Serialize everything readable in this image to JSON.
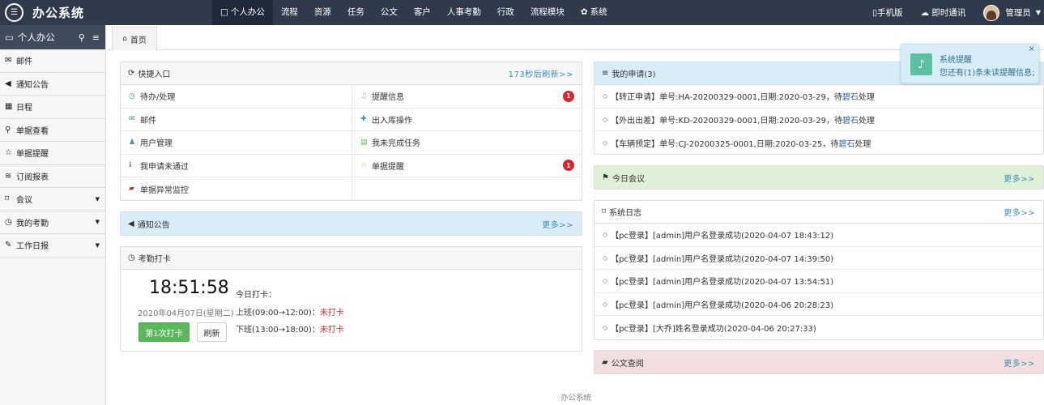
{
  "app": {
    "title": "办公系统"
  },
  "nav": [
    {
      "label": "个人办公",
      "icon": "□"
    },
    {
      "label": "流程"
    },
    {
      "label": "资源"
    },
    {
      "label": "任务"
    },
    {
      "label": "公文"
    },
    {
      "label": "客户"
    },
    {
      "label": "人事考勤"
    },
    {
      "label": "行政"
    },
    {
      "label": "流程模块"
    },
    {
      "label": "系统",
      "icon": "✿"
    }
  ],
  "topright": {
    "mobile": "手机版",
    "chat": "即时通讯",
    "user": "管理员"
  },
  "sidebar": {
    "title": "个人办公",
    "items": [
      {
        "label": "邮件",
        "icon": "✉"
      },
      {
        "label": "通知公告",
        "icon": "◀"
      },
      {
        "label": "日程",
        "icon": "▦"
      },
      {
        "label": "单据查看",
        "icon": "⚲"
      },
      {
        "label": "单据提醒",
        "icon": "☆"
      },
      {
        "label": "订阅报表",
        "icon": "≋"
      },
      {
        "label": "会议",
        "icon": "⌑",
        "dropdown": true
      },
      {
        "label": "我的考勤",
        "icon": "◷",
        "dropdown": true
      },
      {
        "label": "工作日报",
        "icon": "✎",
        "dropdown": true
      }
    ]
  },
  "tab": {
    "home": "首页"
  },
  "quick": {
    "title": "快捷入口",
    "refresh": "173秒后刷新>>",
    "cells": [
      {
        "label": "待办/处理",
        "icon": "◷",
        "color": "#3c8dbc"
      },
      {
        "label": "提醒信息",
        "icon": "♫",
        "color": "#f0ad4e",
        "badge": "1"
      },
      {
        "label": "邮件",
        "icon": "✉",
        "color": "#3c8dbc"
      },
      {
        "label": "出入库操作",
        "icon": "✚",
        "color": "#3c8dbc"
      },
      {
        "label": "用户管理",
        "icon": "♟",
        "color": "#3c8dbc"
      },
      {
        "label": "我未完成任务",
        "icon": "▤",
        "color": "#5cb85c"
      },
      {
        "label": "我申请未通过",
        "icon": "ℹ",
        "color": "#8e6bb8"
      },
      {
        "label": "单据提醒",
        "icon": "☆",
        "color": "#f0ad4e",
        "badge": "1"
      },
      {
        "label": "单据异常监控",
        "icon": "▰",
        "color": "#a94442"
      }
    ]
  },
  "notice": {
    "title": "通知公告",
    "more": "更多>>"
  },
  "clock": {
    "title": "考勤打卡",
    "time": "18:51:58",
    "date": "2020年04月07日(星期二)",
    "punch_button": "第1次打卡",
    "refresh_button": "刷新",
    "today_label": "今日打卡：",
    "work_on": "上班(09:00→12:00)：",
    "work_on_status": "未打卡",
    "work_off": "下班(13:00→18:00)：",
    "work_off_status": "未打卡"
  },
  "apply": {
    "title": "我的申请(3)",
    "rows": [
      {
        "pre": "【转正申请】单号:HA-20200329-0001,日期:2020-03-29，待",
        "who": "碧石",
        "post": "处理"
      },
      {
        "pre": "【外出出差】单号:KD-20200329-0001,日期:2020-03-29，待",
        "who": "碧石",
        "post": "处理"
      },
      {
        "pre": "【车辆预定】单号:CJ-20200325-0001,日期:2020-03-25，待",
        "who": "碧石",
        "post": "处理"
      }
    ]
  },
  "meeting": {
    "title": "今日会议",
    "more": "更多>>"
  },
  "syslog": {
    "title": "系统日志",
    "more": "更多>>",
    "rows": [
      "【pc登录】[admin]用户名登录成功(2020-04-07 18:43:12)",
      "【pc登录】[admin]用户名登录成功(2020-04-07 14:39:50)",
      "【pc登录】[admin]用户名登录成功(2020-04-07 13:54:51)",
      "【pc登录】[admin]用户名登录成功(2020-04-06 20:28:23)",
      "【pc登录】[大乔]姓名登录成功(2020-04-06 20:27:33)"
    ]
  },
  "docs": {
    "title": "公文查阅",
    "more": "更多>>"
  },
  "footer": "办公系统",
  "toast": {
    "title": "系统提醒",
    "message": "您还有(1)条未读提醒信息;",
    "close": "×"
  }
}
